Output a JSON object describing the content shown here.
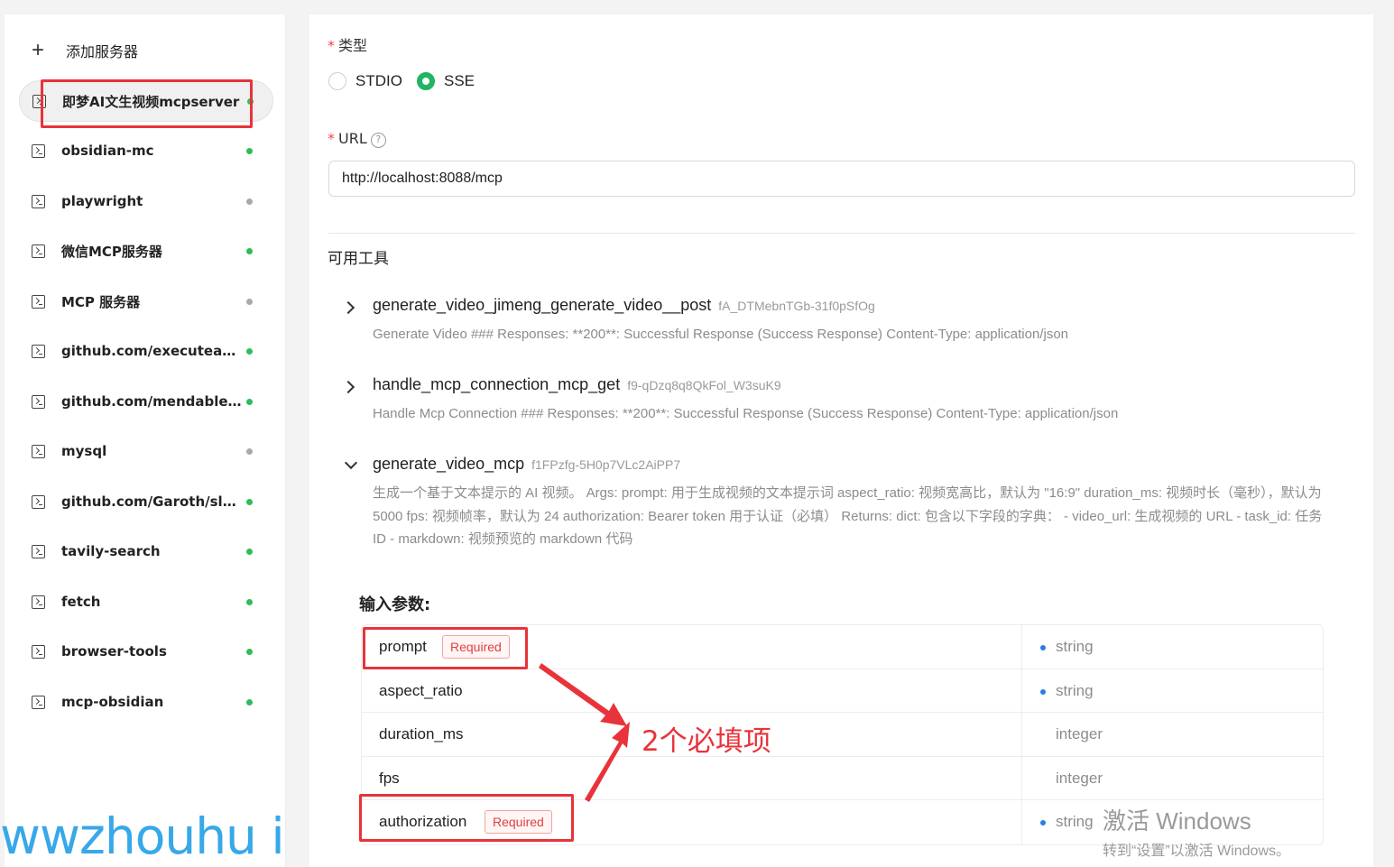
{
  "sidebar": {
    "add_label": "添加服务器",
    "servers": [
      {
        "name": "即梦AI文生视频mcpserver",
        "status": "green"
      },
      {
        "name": "obsidian-mc",
        "status": "green"
      },
      {
        "name": "playwright",
        "status": "gray"
      },
      {
        "name": "微信MCP服务器",
        "status": "green"
      },
      {
        "name": "MCP 服务器",
        "status": "gray"
      },
      {
        "name": "github.com/executeautomation/mcp-playwright",
        "status": "green"
      },
      {
        "name": "github.com/mendableai/firecrawl-mcp-server",
        "status": "green"
      },
      {
        "name": "mysql",
        "status": "gray"
      },
      {
        "name": "github.com/Garoth/sleep-mcp",
        "status": "green"
      },
      {
        "name": "tavily-search",
        "status": "green"
      },
      {
        "name": "fetch",
        "status": "green"
      },
      {
        "name": "browser-tools",
        "status": "green"
      },
      {
        "name": "mcp-obsidian",
        "status": "green"
      }
    ]
  },
  "form": {
    "type_label": "类型",
    "required_mark": "*",
    "type_options": [
      "STDIO",
      "SSE"
    ],
    "type_selected": "SSE",
    "url_label": "URL",
    "help_glyph": "?",
    "url_value": "http://localhost:8088/mcp"
  },
  "tools_section": {
    "title": "可用工具",
    "tools": [
      {
        "name": "generate_video_jimeng_generate_video__post",
        "id": "fA_DTMebnTGb-31f0pSfOg",
        "description": "Generate Video ### Responses: **200**: Successful Response (Success Response) Content-Type: application/json",
        "expanded": false
      },
      {
        "name": "handle_mcp_connection_mcp_get",
        "id": "f9-qDzq8q8QkFol_W3suK9",
        "description": "Handle Mcp Connection ### Responses: **200**: Successful Response (Success Response) Content-Type: application/json",
        "expanded": false
      },
      {
        "name": "generate_video_mcp",
        "id": "f1FPzfg-5H0p7VLc2AiPP7",
        "description": "生成一个基于文本提示的 AI 视频。 Args: prompt: 用于生成视频的文本提示词 aspect_ratio: 视频宽高比，默认为 \"16:9\" duration_ms: 视频时长（毫秒），默认为 5000 fps: 视频帧率，默认为 24 authorization: Bearer token 用于认证（必填） Returns: dict: 包含以下字段的字典： - video_url: 生成视频的 URL - task_id: 任务 ID - markdown: 视频预览的 markdown 代码",
        "expanded": true
      }
    ]
  },
  "params": {
    "title": "输入参数:",
    "required_label": "Required",
    "rows": [
      {
        "name": "prompt",
        "type": "string",
        "required": true
      },
      {
        "name": "aspect_ratio",
        "type": "string",
        "required": false
      },
      {
        "name": "duration_ms",
        "type": "integer",
        "required": false
      },
      {
        "name": "fps",
        "type": "integer",
        "required": false
      },
      {
        "name": "authorization",
        "type": "string",
        "required": true
      }
    ]
  },
  "annotation": {
    "text": "2个必填项",
    "color": "#e8333a"
  },
  "overlay": {
    "watermark": "wwzhouhu i",
    "activate_title": "激活 Windows",
    "activate_sub": "转到“设置”以激活 Windows。"
  },
  "colors": {
    "accent": "#21b563",
    "status_green": "#2ebd59",
    "status_gray": "#a9a9a9",
    "required_red": "#e04040",
    "bullet_blue": "#2d7be5"
  }
}
